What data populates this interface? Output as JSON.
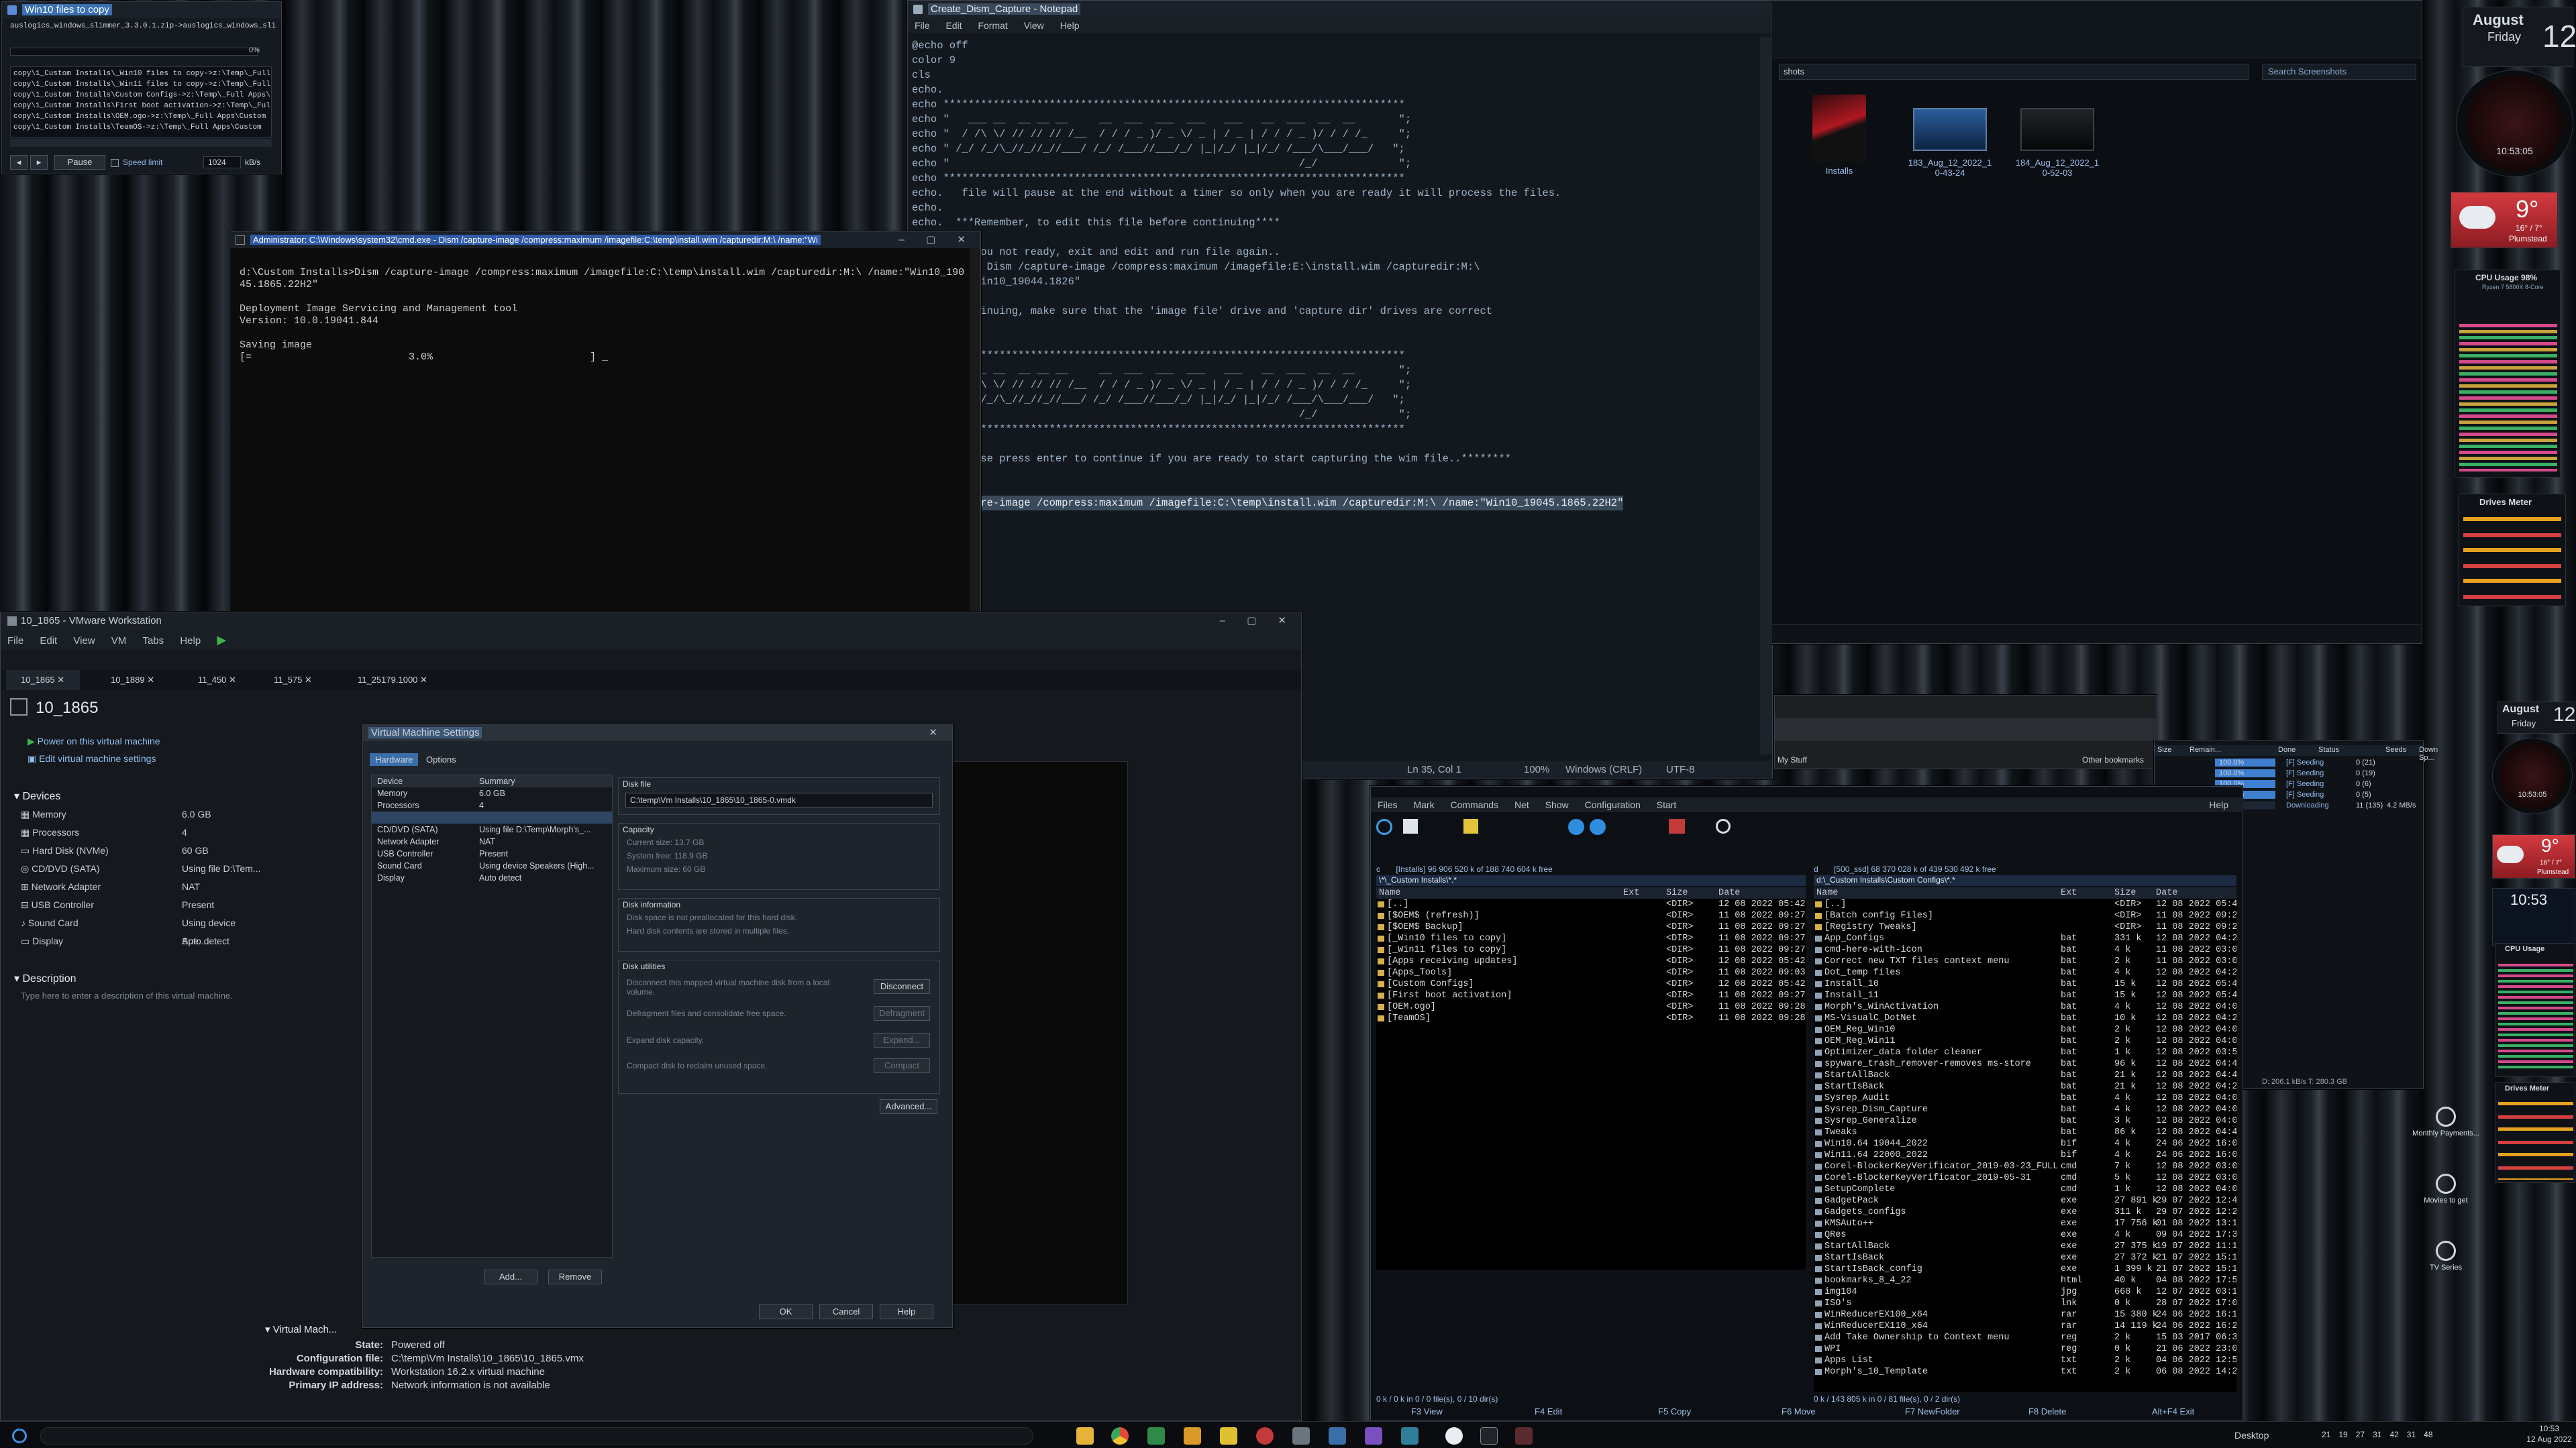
{
  "copy_window": {
    "title": "Win10 files to copy",
    "current_file": "auslogics_windows_slimmer_3.3.0.1.zip->auslogics_windows_sli",
    "percent": "0%",
    "log": [
      "copy\\1_Custom Installs\\_Win10 files to copy->z:\\Temp\\_Full Ap",
      "copy\\1_Custom Installs\\_Win11 files to copy->z:\\Temp\\_Full Ap",
      "copy\\1_Custom Installs\\Custom Configs->z:\\Temp\\_Full Apps\\",
      "copy\\1_Custom Installs\\First boot activation->z:\\Temp\\_Full Ap",
      "copy\\1_Custom Installs\\OEM.ogo->z:\\Temp\\_Full Apps\\Custom",
      "copy\\1_Custom Installs\\TeamOS->z:\\Temp\\_Full Apps\\Custom"
    ],
    "pause_label": "Pause",
    "speed_limit_label": "Speed limit",
    "speed_value": "1024",
    "speed_unit": "kB/s"
  },
  "cmd_window": {
    "title": "Administrator: C:\\Windows\\system32\\cmd.exe - Dism /capture-image /compress:maximum /imagefile:C:\\temp\\install.wim /capturedir:M:\\ /name:\"Wi",
    "lines": [
      "d:\\Custom Installs>Dism /capture-image /compress:maximum /imagefile:C:\\temp\\install.wim /capturedir:M:\\ /name:\"Win10_190",
      "45.1865.22H2\"",
      "",
      "Deployment Image Servicing and Management tool",
      "Version: 10.0.19041.844",
      "",
      "Saving image",
      "[=                          3.0%                          ] _"
    ],
    "progress": 3.0
  },
  "notepad": {
    "title": "Create_Dism_Capture - Notepad",
    "menu": [
      "File",
      "Edit",
      "Format",
      "View",
      "Help"
    ],
    "lines": [
      "@echo off",
      "color 9",
      "cls",
      "echo.",
      "echo **************************************************************************",
      "echo \"   ___ __  __ __ __     __  ___  ___  ___   ___   __  ___  __  __       \";",
      "echo \"  / /\\ \\/ // // // /__  / / / _ )/ _ \\/ _ | / _ | / / / _ )/ / / /_     \";",
      "echo \" /_/ /_/\\_//_//_//___/ /_/ /___//___/_/ |_|/_/ |_|/_/ /___/\\___/___/   \";",
      "echo \"                                                        /_/             \";",
      "echo **************************************************************************",
      "echo.   file will pause at the end without a timer so only when you are ready it will process the files.",
      "echo.",
      "echo.  ***Remember, to edit this file before continuing****",
      "echo.",
      "echo.  if you not ready, exit and edit and run file again..",
      "echo.  use: Dism /capture-image /compress:maximum /imagefile:E:\\install.wim /capturedir:M:\\",
      "echo.  \"s_Win10_19044.1826\"",
      "echo.",
      "echo.  continuing, make sure that the 'image file' drive and 'capture dir' drives are correct",
      "echo.",
      "echo.",
      "echo **************************************************************************",
      "echo \"   ___ __  __ __ __     __  ___  ___  ___   ___   __  ___  __  __       \";",
      "echo \"  / /\\ \\/ // // // /__  / / / _ )/ _ \\/ _ | / _ | / / / _ )/ / / /_     \";",
      "echo \" /_/ /_/\\_//_//_//___/ /_/ /___//___/_/ |_|/_/ |_|/_/ /___/\\___/___/   \";",
      "echo \"                                                        /_/             \";",
      "echo **************************************************************************",
      "echo.",
      "echo.  Please press enter to continue if you are ready to start capturing the wim file..********",
      "echo.",
      "echo.",
      "Dism /capture-image /compress:maximum /imagefile:C:\\temp\\install.wim /capturedir:M:\\ /name:\"Win10_19045.1865.22H2\""
    ],
    "status_pos": "Ln 35, Col 1",
    "status_zoom": "100%",
    "status_eol": "Windows (CRLF)",
    "status_enc": "UTF-8"
  },
  "explorer": {
    "breadcrumb": "shots",
    "search_placeholder": "Search Screenshots",
    "items": [
      {
        "label": "Installs"
      },
      {
        "label": "183_Aug_12_2022_10-43-24"
      },
      {
        "label": "184_Aug_12_2022_10-52-03"
      }
    ]
  },
  "vmware": {
    "title": "10_1865 - VMware Workstation",
    "menu": [
      "File",
      "Edit",
      "View",
      "VM",
      "Tabs",
      "Help"
    ],
    "tabs": [
      "10_1865",
      "10_1889",
      "11_450",
      "11_575",
      "11_25179.1000"
    ],
    "vm_name": "10_1865",
    "actions": [
      "Power on this virtual machine",
      "Edit virtual machine settings"
    ],
    "devices_header": "Devices",
    "devices": [
      {
        "name": "Memory",
        "value": "6.0 GB"
      },
      {
        "name": "Processors",
        "value": "4"
      },
      {
        "name": "Hard Disk (NVMe)",
        "value": "60 GB"
      },
      {
        "name": "CD/DVD (SATA)",
        "value": "Using file D:\\Tem..."
      },
      {
        "name": "Network Adapter",
        "value": "NAT"
      },
      {
        "name": "USB Controller",
        "value": "Present"
      },
      {
        "name": "Sound Card",
        "value": "Using device Spe..."
      },
      {
        "name": "Display",
        "value": "Auto detect"
      }
    ],
    "description_header": "Description",
    "description_placeholder": "Type here to enter a description of this virtual machine.",
    "details_header": "Virtual Mach...",
    "details": [
      {
        "k": "State:",
        "v": "Powered off"
      },
      {
        "k": "Configuration file:",
        "v": "C:\\temp\\Vm Installs\\10_1865\\10_1865.vmx"
      },
      {
        "k": "Hardware compatibility:",
        "v": "Workstation 16.2.x virtual machine"
      },
      {
        "k": "Primary IP address:",
        "v": "Network information is not available"
      }
    ]
  },
  "vm_settings": {
    "title": "Virtual Machine Settings",
    "tabs": [
      "Hardware",
      "Options"
    ],
    "col_device": "Device",
    "col_summary": "Summary",
    "rows": [
      {
        "d": "Memory",
        "s": "6.0 GB"
      },
      {
        "d": "Processors",
        "s": "4"
      },
      {
        "d": "",
        "s": ""
      },
      {
        "d": "CD/DVD (SATA)",
        "s": "Using file D:\\Temp\\Morph's_..."
      },
      {
        "d": "Network Adapter",
        "s": "NAT"
      },
      {
        "d": "USB Controller",
        "s": "Present"
      },
      {
        "d": "Sound Card",
        "s": "Using device Speakers (High..."
      },
      {
        "d": "Display",
        "s": "Auto detect"
      }
    ],
    "disk_file_label": "Disk file",
    "disk_file": "C:\\temp\\Vm Installs\\10_1865\\10_1865-0.vmdk",
    "capacity_label": "Capacity",
    "capacity_lines": [
      "Current size: 13.7 GB",
      "System free: 118.9 GB",
      "Maximum size: 60 GB"
    ],
    "disk_info_label": "Disk information",
    "disk_info_lines": [
      "Disk space is not preallocated for this hard disk.",
      "Hard disk contents are stored in multiple files."
    ],
    "utilities_label": "Disk utilities",
    "utilities": [
      {
        "text": "Disconnect this mapped virtual machine disk from a local volume.",
        "btn": "Disconnect"
      },
      {
        "text": "Defragment files and consolidate free space.",
        "btn": "Defragment"
      },
      {
        "text": "Expand disk capacity.",
        "btn": "Expand..."
      },
      {
        "text": "Compact disk to reclaim unused space.",
        "btn": "Compact"
      }
    ],
    "advanced": "Advanced...",
    "add": "Add...",
    "remove": "Remove",
    "ok": "OK",
    "cancel": "Cancel",
    "help": "Help"
  },
  "browser_strip": {
    "bookmark": "My Stuff",
    "other_bookmarks": "Other bookmarks"
  },
  "torrent": {
    "cols": [
      "Size",
      "Remain...",
      "Done",
      "Status",
      "Seeds",
      "Down Sp...",
      "Up Sp"
    ],
    "rows": [
      {
        "done": "100.0%",
        "status": "[F] Seeding",
        "seeds": "0 (21)"
      },
      {
        "done": "100.0%",
        "status": "[F] Seeding",
        "seeds": "0 (19)"
      },
      {
        "done": "100.0%",
        "status": "[F] Seeding",
        "seeds": "0 (6)"
      },
      {
        "done": "100.0%",
        "status": "[F] Seeding",
        "seeds": "0 (5)"
      },
      {
        "done": "16.1%",
        "status": "Downloading",
        "seeds": "11 (135)",
        "down": "4.2 MB/s"
      }
    ],
    "footer": "D: 206.1 kB/s T: 280.3 GB"
  },
  "tc": {
    "menu": [
      "Files",
      "Mark",
      "Commands",
      "Net",
      "Show",
      "Configuration",
      "Start"
    ],
    "help": "Help",
    "left_drive": "c",
    "left_info": "[Installs] 96 906 520 k of 188 740 604 k free",
    "left_path": "\\*\\_Custom Installs\\*.*",
    "right_drive": "d",
    "right_info": "[500_ssd] 68 370 028 k of 439 530 492 k free",
    "right_path": "d:\\_Custom Installs\\Custom Configs\\*.*",
    "headers": [
      "Name",
      "Ext",
      "Size",
      "Date"
    ],
    "left_rows": [
      {
        "n": "[..]",
        "e": "",
        "s": "<DIR>",
        "d": "12 08 2022 05:42"
      },
      {
        "n": "[$OEM$ (refresh)]",
        "e": "",
        "s": "<DIR>",
        "d": "11 08 2022 09:27"
      },
      {
        "n": "[$OEM$ Backup]",
        "e": "",
        "s": "<DIR>",
        "d": "11 08 2022 09:27"
      },
      {
        "n": "[_Win10 files to copy]",
        "e": "",
        "s": "<DIR>",
        "d": "11 08 2022 09:27"
      },
      {
        "n": "[_Win11 files to copy]",
        "e": "",
        "s": "<DIR>",
        "d": "11 08 2022 09:27"
      },
      {
        "n": "[Apps receiving updates]",
        "e": "",
        "s": "<DIR>",
        "d": "12 08 2022 05:42"
      },
      {
        "n": "[Apps_Tools]",
        "e": "",
        "s": "<DIR>",
        "d": "11 08 2022 09:03"
      },
      {
        "n": "[Custom Configs]",
        "e": "",
        "s": "<DIR>",
        "d": "12 08 2022 05:42"
      },
      {
        "n": "[First boot activation]",
        "e": "",
        "s": "<DIR>",
        "d": "11 08 2022 09:27"
      },
      {
        "n": "[OEM.ogo]",
        "e": "",
        "s": "<DIR>",
        "d": "11 08 2022 09:28"
      },
      {
        "n": "[TeamOS]",
        "e": "",
        "s": "<DIR>",
        "d": "11 08 2022 09:28"
      }
    ],
    "right_rows": [
      {
        "n": "[..]",
        "e": "",
        "s": "<DIR>",
        "d": "12 08 2022 05:4"
      },
      {
        "n": "[Batch config Files]",
        "e": "",
        "s": "<DIR>",
        "d": "11 08 2022 09:2"
      },
      {
        "n": "[Registry Tweaks]",
        "e": "",
        "s": "<DIR>",
        "d": "11 08 2022 09:2"
      },
      {
        "n": "App_Configs",
        "e": "bat",
        "s": "331 k",
        "d": "12 08 2022 04:2"
      },
      {
        "n": "cmd-here-with-icon",
        "e": "bat",
        "s": "4 k",
        "d": "11 08 2022 03:0"
      },
      {
        "n": "Correct new TXT files context menu",
        "e": "bat",
        "s": "2 k",
        "d": "11 08 2022 03:0"
      },
      {
        "n": "Dot_temp files",
        "e": "bat",
        "s": "4 k",
        "d": "12 08 2022 04:2"
      },
      {
        "n": "Install_10",
        "e": "bat",
        "s": "15 k",
        "d": "12 08 2022 05:4"
      },
      {
        "n": "Install_11",
        "e": "bat",
        "s": "15 k",
        "d": "12 08 2022 05:4"
      },
      {
        "n": "Morph's_WinActivation",
        "e": "bat",
        "s": "4 k",
        "d": "12 08 2022 04:0"
      },
      {
        "n": "MS-VisualC_DotNet",
        "e": "bat",
        "s": "10 k",
        "d": "12 08 2022 04:2"
      },
      {
        "n": "OEM_Reg_Win10",
        "e": "bat",
        "s": "2 k",
        "d": "12 08 2022 04:0"
      },
      {
        "n": "OEM_Reg_Win11",
        "e": "bat",
        "s": "2 k",
        "d": "12 08 2022 04:0"
      },
      {
        "n": "Optimizer_data folder cleaner",
        "e": "bat",
        "s": "1 k",
        "d": "12 08 2022 03:5"
      },
      {
        "n": "spyware_trash_remover-removes ms-store",
        "e": "bat",
        "s": "96 k",
        "d": "12 08 2022 04:4"
      },
      {
        "n": "StartAllBack",
        "e": "bat",
        "s": "21 k",
        "d": "12 08 2022 04:4"
      },
      {
        "n": "StartIsBack",
        "e": "bat",
        "s": "21 k",
        "d": "12 08 2022 04:2"
      },
      {
        "n": "Sysrep_Audit",
        "e": "bat",
        "s": "4 k",
        "d": "12 08 2022 04:0"
      },
      {
        "n": "Sysrep_Dism_Capture",
        "e": "bat",
        "s": "4 k",
        "d": "12 08 2022 04:0"
      },
      {
        "n": "Sysrep_Generalize",
        "e": "bat",
        "s": "3 k",
        "d": "12 08 2022 04:0"
      },
      {
        "n": "Tweaks",
        "e": "bat",
        "s": "86 k",
        "d": "12 08 2022 04:4"
      },
      {
        "n": "Win10.64 19044_2022",
        "e": "bif",
        "s": "4 k",
        "d": "24 06 2022 16:0"
      },
      {
        "n": "Win11.64 22000_2022",
        "e": "bif",
        "s": "4 k",
        "d": "24 06 2022 16:0"
      },
      {
        "n": "Corel-BlockerKeyVerificator_2019-03-23_FULL",
        "e": "cmd",
        "s": "7 k",
        "d": "12 08 2022 03:0"
      },
      {
        "n": "Corel-BlockerKeyVerificator_2019-05-31",
        "e": "cmd",
        "s": "5 k",
        "d": "12 08 2022 03:0"
      },
      {
        "n": "SetupComplete",
        "e": "cmd",
        "s": "1 k",
        "d": "12 08 2022 04:0"
      },
      {
        "n": "GadgetPack",
        "e": "exe",
        "s": "27 891 k",
        "d": "29 07 2022 12:4"
      },
      {
        "n": "Gadgets_configs",
        "e": "exe",
        "s": "311 k",
        "d": "29 07 2022 12:2"
      },
      {
        "n": "KMSAuto++",
        "e": "exe",
        "s": "17 756 k",
        "d": "01 08 2022 13:1"
      },
      {
        "n": "QRes",
        "e": "exe",
        "s": "4 k",
        "d": "09 04 2022 17:3"
      },
      {
        "n": "StartAllBack",
        "e": "exe",
        "s": "27 375 k",
        "d": "19 07 2022 11:1"
      },
      {
        "n": "StartIsBack",
        "e": "exe",
        "s": "27 372 k",
        "d": "21 07 2022 15:1"
      },
      {
        "n": "StartIsBack_config",
        "e": "exe",
        "s": "1 399 k",
        "d": "21 07 2022 15:1"
      },
      {
        "n": "bookmarks_8_4_22",
        "e": "html",
        "s": "40 k",
        "d": "04 08 2022 17:5"
      },
      {
        "n": "img104",
        "e": "jpg",
        "s": "668 k",
        "d": "12 07 2022 03:1"
      },
      {
        "n": "ISO's",
        "e": "lnk",
        "s": "0 k",
        "d": "28 07 2022 17:0"
      },
      {
        "n": "WinReducerEX100_x64",
        "e": "rar",
        "s": "15 380 k",
        "d": "24 06 2022 16:1"
      },
      {
        "n": "WinReducerEX110_x64",
        "e": "rar",
        "s": "14 119 k",
        "d": "24 06 2022 16:2"
      },
      {
        "n": "Add Take Ownership to Context menu",
        "e": "reg",
        "s": "2 k",
        "d": "15 03 2017 06:3"
      },
      {
        "n": "WPI",
        "e": "reg",
        "s": "0 k",
        "d": "21 06 2022 23:0"
      },
      {
        "n": "Apps List",
        "e": "txt",
        "s": "2 k",
        "d": "04 06 2022 12:5"
      },
      {
        "n": "Morph's_10_Template",
        "e": "txt",
        "s": "2 k",
        "d": "06 08 2022 14:2"
      }
    ],
    "left_footer": "0 k / 0 k in 0 / 0 file(s), 0 / 10 dir(s)",
    "right_footer": "0 k / 143 805 k in 0 / 81 file(s), 0 / 2 dir(s)",
    "fkeys": [
      "F3 View",
      "F4 Edit",
      "F5 Copy",
      "F6 Move",
      "F7 NewFolder",
      "F8 Delete",
      "Alt+F4 Exit"
    ]
  },
  "gadgets": {
    "month": "August",
    "weekday": "Friday",
    "day": "12",
    "clock_time": "10:53:05",
    "clock_time2": "10:53:05",
    "weather_temp": "9°",
    "weather_range": "16° / 7°",
    "weather_place": "Plumstead",
    "cpu_label": "CPU Usage",
    "cpu_value": "98%",
    "cpu_model": "Ryzen 7 5800X 8-Core",
    "drives_label": "Drives Meter",
    "time_small": "10:53",
    "desktop_links": [
      "Monthly Payments...",
      "Movies to get",
      "TV Series"
    ]
  },
  "taskbar": {
    "desktop_label": "Desktop",
    "time": "10:53",
    "date": "12 Aug 2022",
    "tray_numbers": [
      "21",
      "19",
      "27",
      "31",
      "42",
      "31",
      "48"
    ]
  }
}
